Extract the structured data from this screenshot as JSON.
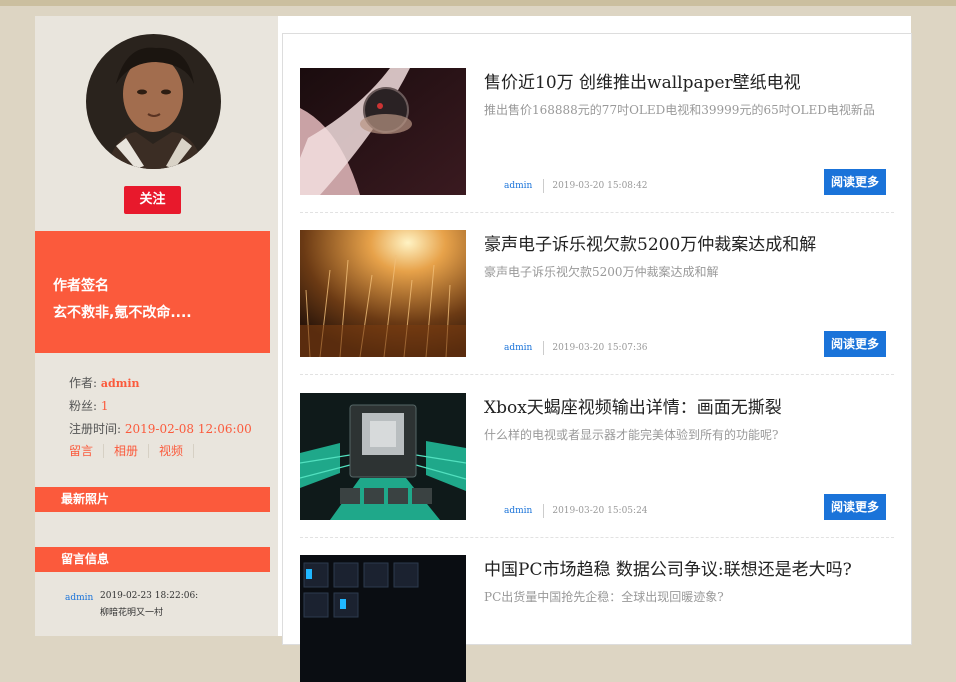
{
  "sidebar": {
    "follow_label": "关注",
    "signature_title": "作者签名",
    "signature_text": "玄不救非,氪不改命....",
    "author_label": "作者:",
    "author_value": "admin",
    "fans_label": "粉丝:",
    "fans_value": "1",
    "reg_label": "注册时间:",
    "reg_value": "2019-02-08 12:06:00",
    "links": [
      "留言",
      "相册",
      "视频"
    ],
    "photos_title": "最新照片",
    "messages_title": "留言信息",
    "message": {
      "user": "admin",
      "time": "2019-02-23 18:22:06:",
      "text": "柳暗花明又一村"
    }
  },
  "articles": [
    {
      "title": "售价近10万 创维推出wallpaper壁纸电视",
      "summary": "推出售价168888元的77吋OLED电视和39999元的65吋OLED电视新品",
      "author": "admin",
      "time": "2019-03-20 15:08:42",
      "more": "阅读更多"
    },
    {
      "title": "豪声电子诉乐视欠款5200万仲裁案达成和解",
      "summary": "豪声电子诉乐视欠款5200万仲裁案达成和解",
      "author": "admin",
      "time": "2019-03-20 15:07:36",
      "more": "阅读更多"
    },
    {
      "title": "Xbox天蝎座视频输出详情：画面无撕裂",
      "summary": "什么样的电视或者显示器才能完美体验到所有的功能呢?",
      "author": "admin",
      "time": "2019-03-20 15:05:24",
      "more": "阅读更多"
    },
    {
      "title": "中国PC市场趋稳 数据公司争议:联想还是老大吗?",
      "summary": "PC出货量中国抢先企稳：全球出现回暖迹象?"
    }
  ]
}
